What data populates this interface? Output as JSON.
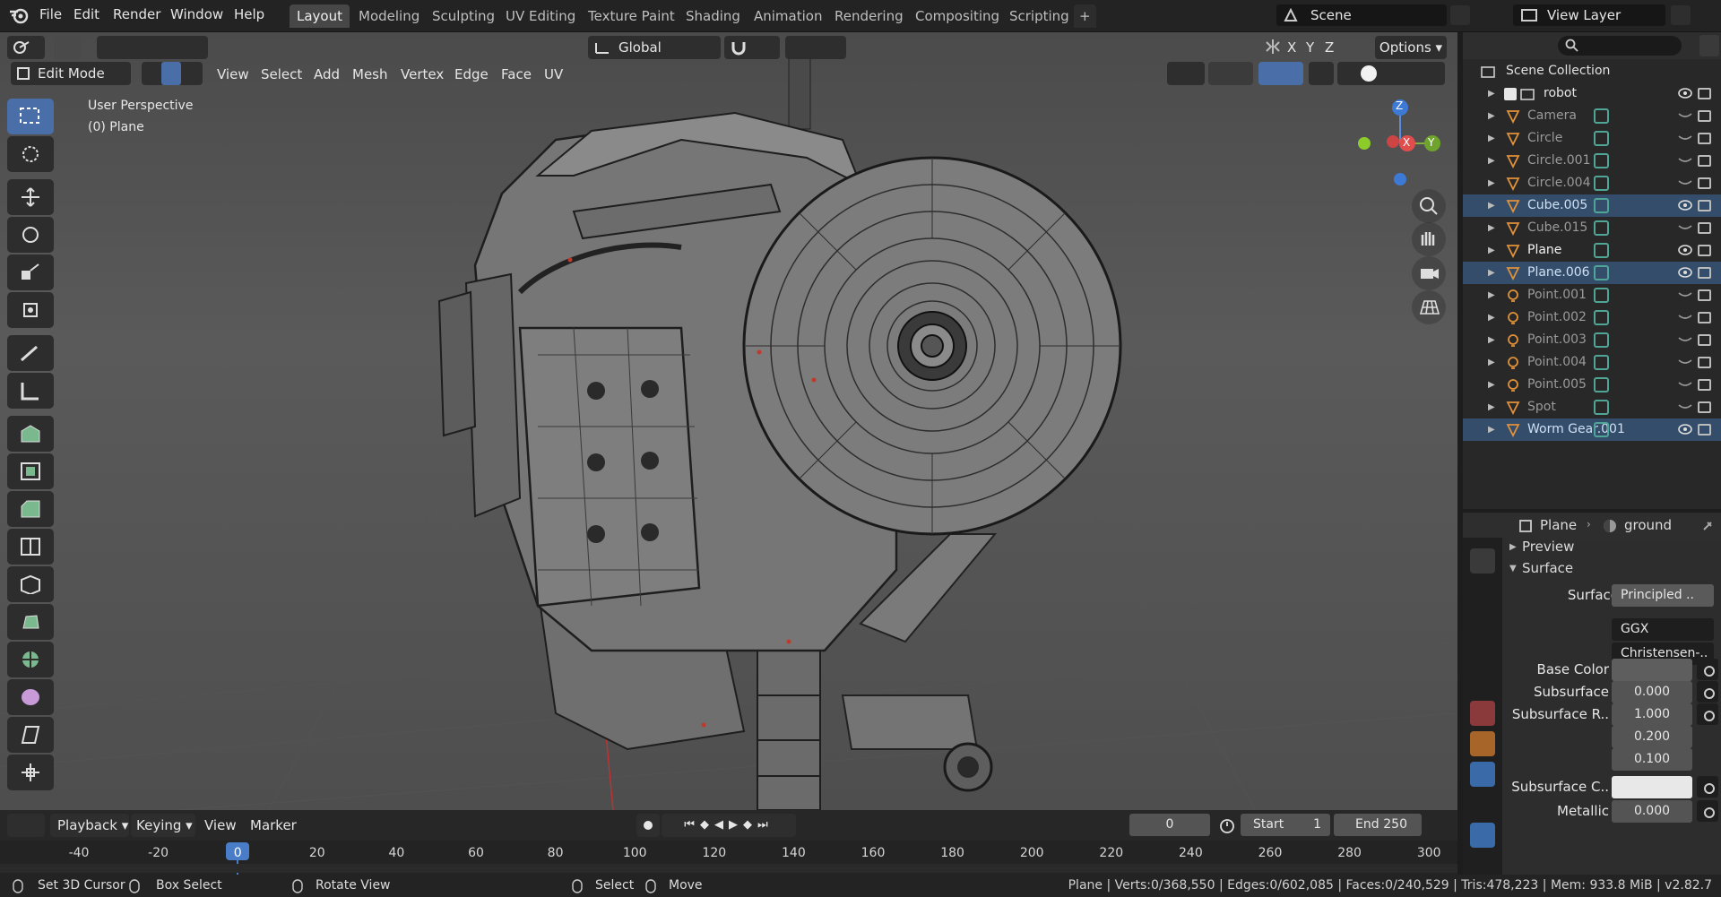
{
  "menu": {
    "file": "File",
    "edit": "Edit",
    "render": "Render",
    "window": "Window",
    "help": "Help"
  },
  "workspaces": [
    "Layout",
    "Modeling",
    "Sculpting",
    "UV Editing",
    "Texture Paint",
    "Shading",
    "Animation",
    "Rendering",
    "Compositing",
    "Scripting"
  ],
  "add_tab": "+",
  "scene": {
    "name": "Scene",
    "view_layer": "View Layer"
  },
  "viewport": {
    "mode": "Edit Mode",
    "menus": [
      "View",
      "Select",
      "Add",
      "Mesh",
      "Vertex",
      "Edge",
      "Face",
      "UV"
    ],
    "orientation": "Global",
    "axes": [
      "X",
      "Y",
      "Z"
    ],
    "options": "Options",
    "overlay_title": "User Perspective",
    "overlay_object": "(0) Plane",
    "gizmo": {
      "z": "Z",
      "x": "X",
      "y": "Y"
    }
  },
  "outliner": {
    "root": "Scene Collection",
    "collection": "robot",
    "items": [
      {
        "name": "Camera",
        "selected": false
      },
      {
        "name": "Circle",
        "selected": false
      },
      {
        "name": "Circle.001",
        "selected": false
      },
      {
        "name": "Circle.004",
        "selected": false
      },
      {
        "name": "Cube.005",
        "selected": true
      },
      {
        "name": "Cube.015",
        "selected": false
      },
      {
        "name": "Plane",
        "selected": false,
        "active": true
      },
      {
        "name": "Plane.006",
        "selected": true
      },
      {
        "name": "Point.001",
        "selected": false
      },
      {
        "name": "Point.002",
        "selected": false
      },
      {
        "name": "Point.003",
        "selected": false
      },
      {
        "name": "Point.004",
        "selected": false
      },
      {
        "name": "Point.005",
        "selected": false
      },
      {
        "name": "Spot",
        "selected": false
      },
      {
        "name": "Worm Gear.001",
        "selected": true
      }
    ]
  },
  "properties": {
    "object": "Plane",
    "material": "ground",
    "preview": "Preview",
    "surface_panel": "Surface",
    "surface_label": "Surface",
    "surface_value": "Principled ..",
    "distribution": "GGX",
    "subsurface_method": "Christensen-..",
    "base_color_label": "Base Color",
    "subsurface_label": "Subsurface",
    "subsurface_value": "0.000",
    "subsurface_radius_label": "Subsurface R..",
    "subsurface_radius": [
      "1.000",
      "0.200",
      "0.100"
    ],
    "subsurface_color_label": "Subsurface C..",
    "metallic_label": "Metallic",
    "metallic_value": "0.000"
  },
  "timeline": {
    "menus": [
      "Playback",
      "Keying",
      "View",
      "Marker"
    ],
    "current_frame": "0",
    "start_label": "Start",
    "start": "1",
    "end_label": "End",
    "end": "250",
    "ticks": [
      "-40",
      "-20",
      "0",
      "20",
      "40",
      "60",
      "80",
      "100",
      "120",
      "140",
      "160",
      "180",
      "200",
      "220",
      "240",
      "260",
      "280",
      "300"
    ]
  },
  "status": {
    "left": [
      "Set 3D Cursor",
      "Box Select",
      "Rotate View",
      "Select",
      "Move"
    ],
    "stats": "Plane | Verts:0/368,550 | Edges:0/602,085 | Faces:0/240,529 | Tris:478,223 | Mem: 933.8 MiB | v2.82.7"
  },
  "colors": {
    "accent": "#4a6ea8",
    "selected_row": "#334d6a",
    "mesh_dark": "#2a2a2a",
    "mesh_light": "#8a8a8a",
    "object_orange": "#e0913a",
    "data_teal": "#4fa596"
  }
}
